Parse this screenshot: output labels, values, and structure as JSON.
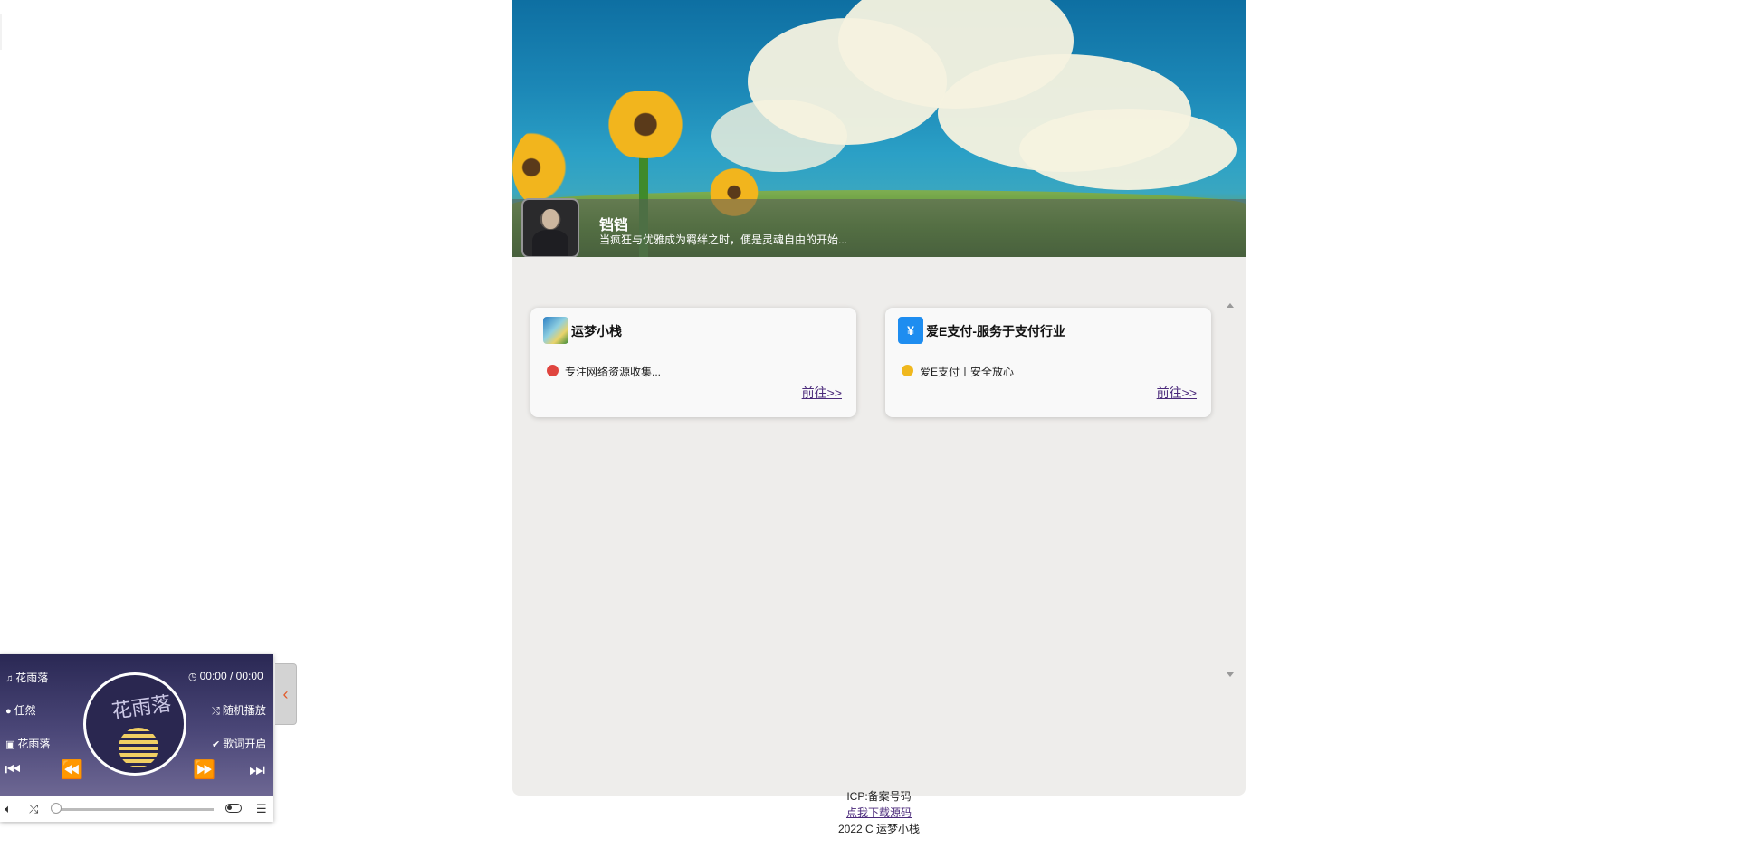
{
  "profile": {
    "name": "铛铛",
    "motto": "当疯狂与优雅成为羁绊之时，便是灵魂自由的开始..."
  },
  "cards": [
    {
      "title": "运梦小栈",
      "description": "专注网络资源收集...",
      "link": "前往>>",
      "logo_color": "#3b8fd1",
      "badge_color": "#e0453f"
    },
    {
      "title": "爱E支付-服务于支付行业",
      "description": "爱E支付丨安全放心",
      "link": "前往>>",
      "logo_color": "#1e8df0",
      "badge_color": "#f0b81e"
    }
  ],
  "footer": {
    "icp": "ICP:备案号码",
    "download_link": "点我下载源码",
    "copyright": "2022 C 运梦小栈"
  },
  "player": {
    "song": "花雨落",
    "artist": "任然",
    "album": "花雨落",
    "time": "00:00 / 00:00",
    "mode": "随机播放",
    "lyrics": "歌词开启",
    "disc_text": "花雨落",
    "progress": 0,
    "handle_icon": "chevron-left-icon"
  }
}
